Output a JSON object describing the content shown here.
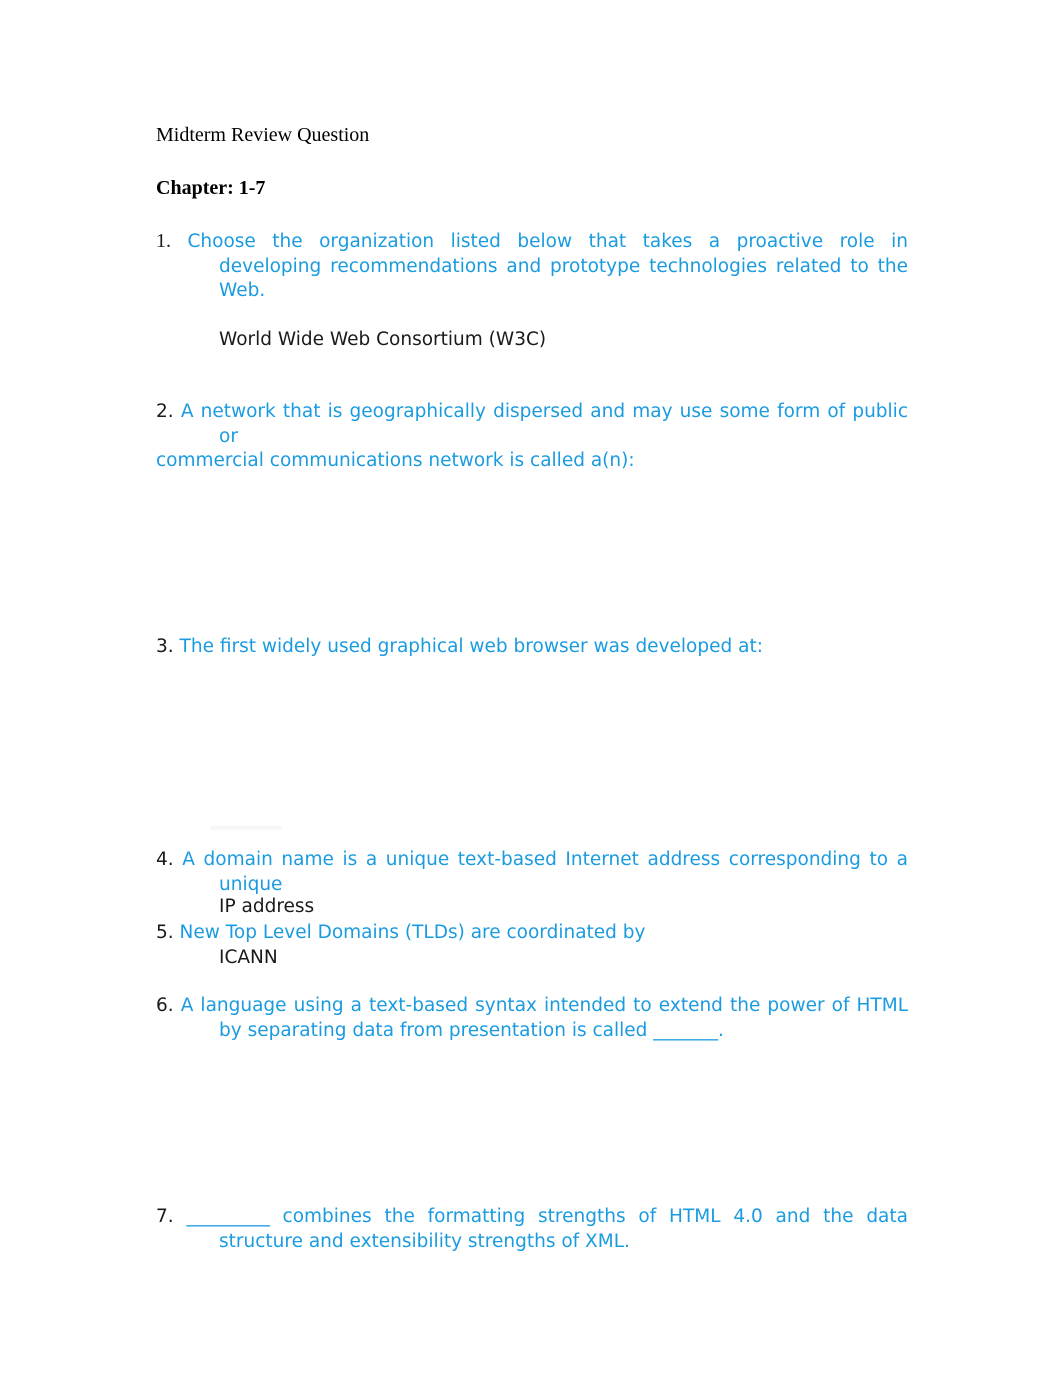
{
  "document": {
    "title": "Midterm Review Question",
    "chapter": "Chapter: 1-7",
    "colors": {
      "question_text": "#1a9be0",
      "answer_text": "#1a1a1a"
    },
    "questions": [
      {
        "number": "1.",
        "lines": [
          "Choose the organization listed below that takes a proactive role in",
          "developing recommendations and prototype technologies related to the",
          "Web."
        ],
        "answer": "World Wide Web Consortium (W3C)"
      },
      {
        "number": "2.",
        "lines": [
          "A network that is geographically dispersed and may use some form of public",
          "or",
          "commercial communications network is called a(n):"
        ],
        "answer": ""
      },
      {
        "number": "3.",
        "lines": [
          "The first widely used graphical web browser was developed at:"
        ],
        "answer": ""
      },
      {
        "number": "4.",
        "lines": [
          "A domain name is a unique text-based Internet address corresponding to a",
          "unique"
        ],
        "answer": "IP address"
      },
      {
        "number": "5.",
        "lines": [
          "New Top Level Domains (TLDs) are coordinated by"
        ],
        "answer": "ICANN"
      },
      {
        "number": "6.",
        "lines": [
          "A language using a text-based syntax intended to extend the power of HTML",
          "by separating data from presentation is called _______."
        ],
        "answer": ""
      },
      {
        "number": "7.",
        "lines": [
          "_________ combines the formatting strengths of HTML 4.0 and the data",
          "structure and extensibility strengths of XML."
        ],
        "answer": ""
      }
    ]
  }
}
